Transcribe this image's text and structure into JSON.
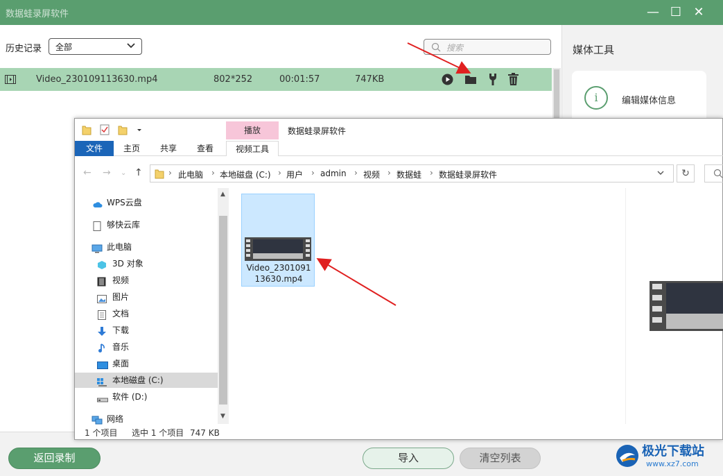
{
  "app": {
    "title": "数据蛙录屏软件",
    "minimize": "—",
    "maximize": "☐",
    "close": "✕"
  },
  "history": {
    "label": "历史记录",
    "selected": "全部",
    "chevron": "⌄"
  },
  "search": {
    "placeholder": "搜索"
  },
  "record": {
    "filename": "Video_230109113630.mp4",
    "resolution": "802*252",
    "duration": "00:01:57",
    "size": "747KB"
  },
  "media_tools": {
    "title": "媒体工具",
    "info_label": "编辑媒体信息",
    "info_glyph": "i"
  },
  "bottom": {
    "back": "返回录制",
    "import": "导入",
    "clear": "清空列表"
  },
  "watermark": {
    "text": "极光下载站",
    "url": "www.xz7.com"
  },
  "explorer": {
    "context_tab": "播放",
    "title": "数据蛙录屏软件",
    "tabs": [
      "文件",
      "主页",
      "共享",
      "查看",
      "视频工具"
    ],
    "breadcrumb": [
      "此电脑",
      "本地磁盘 (C:)",
      "用户",
      "admin",
      "视频",
      "数据蛙",
      "数据蛙录屏软件"
    ],
    "nav": [
      "WPS云盘",
      "够快云库",
      "此电脑",
      "3D 对象",
      "视频",
      "图片",
      "文档",
      "下载",
      "音乐",
      "桌面",
      "本地磁盘 (C:)",
      "软件 (D:)",
      "网络"
    ],
    "file_label": "Video_2301091 13630.mp4",
    "status": {
      "count": "1 个项目",
      "selected": "选中 1 个项目",
      "size": "747 KB"
    }
  },
  "colors": {
    "accent": "#5a9e6f",
    "row_highlight": "#a8d5b4",
    "file_tab": "#1b65b8",
    "arrow": "#e02020"
  }
}
